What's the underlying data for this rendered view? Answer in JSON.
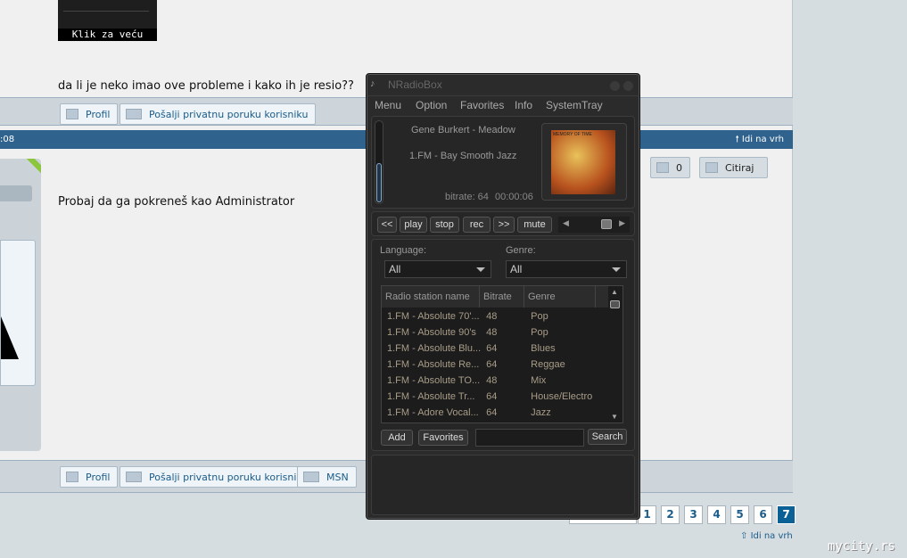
{
  "forum": {
    "thumb_caption": "Klik za veću",
    "post1_text": "da li je neko imao ove probleme i kako ih je resio??",
    "profile_label": "Profil",
    "pm_label": "Pošalji privatnu poruku korisniku",
    "msn_label": "MSN",
    "header_time": ":08",
    "go_top": "Idi na vrh",
    "post2_text": "Probaj da ga pokreneš kao Administrator",
    "like_count": "0",
    "quote_label": "Citiraj",
    "pages": [
      "1",
      "2",
      "3",
      "4",
      "5",
      "6",
      "7"
    ],
    "current_page": "7",
    "watermark": "mycity.rs"
  },
  "player": {
    "title": "NRadioBox",
    "menu": [
      "Menu",
      "Option",
      "Favorites",
      "Info",
      "SystemTray"
    ],
    "track": "Gene Burkert - Meadow",
    "station": "1.FM - Bay Smooth Jazz",
    "bitrate": "bitrate: 64",
    "time": "00:00:06",
    "album_art_text": "MEMORY OF TIME",
    "controls": [
      "<<",
      "play",
      "stop",
      "rec",
      ">>",
      "mute"
    ],
    "language_label": "Language:",
    "language_value": "All",
    "genre_label": "Genre:",
    "genre_value": "All",
    "columns": [
      "Radio station name",
      "Bitrate",
      "Genre"
    ],
    "rows": [
      [
        "1.FM - Absolute 70'...",
        "48",
        "Pop"
      ],
      [
        "1.FM - Absolute 90's",
        "48",
        "Pop"
      ],
      [
        "1.FM - Absolute Blu...",
        "64",
        "Blues"
      ],
      [
        "1.FM - Absolute Re...",
        "64",
        "Reggae"
      ],
      [
        "1.FM - Absolute TO...",
        "48",
        "Mix"
      ],
      [
        "1.FM - Absolute Tr...",
        "64",
        "House/Electro"
      ],
      [
        "1.FM - Adore Vocal...",
        "64",
        "Jazz"
      ]
    ],
    "add_label": "Add",
    "favorites_label": "Favorites",
    "search_value": "",
    "search_label": "Search",
    "volume": 0.85
  }
}
